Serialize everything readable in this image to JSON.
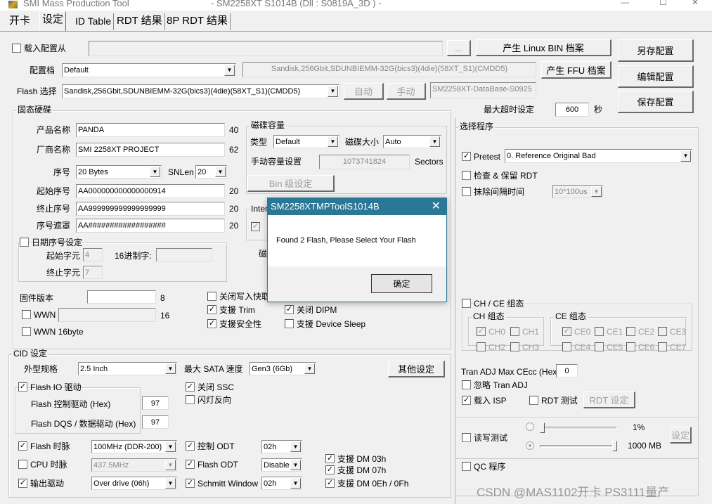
{
  "window": {
    "app_title": "SMI Mass Production Tool",
    "subtitle": "- SM2258XT    S1014B     (Dll : S0819A_3D ) -",
    "min": "—",
    "max": "☐",
    "close": "✕"
  },
  "tabs": [
    "开卡",
    "设定",
    "ID Table",
    "RDT 结果",
    "8P RDT 结果"
  ],
  "active_tab": "设定",
  "top": {
    "load_config": {
      "label": "载入配置从",
      "checked": false
    },
    "load_path": "",
    "browse": "...",
    "linux_bin": "产生 Linux BIN 档案",
    "save_as": "另存配置",
    "config_label": "配置档",
    "config_value": "Default",
    "config_info": "Sandisk,256Gbit,SDUNBIEMM-32G(bics3)(4die)(58XT_S1)(CMDD5)",
    "ffu": "产生 FFU 档案",
    "edit": "编辑配置",
    "flash_label": "Flash 选择",
    "flash_value": "Sandisk,256Gbit,SDUNBIEMM-32G(bics3)(4die)(58XT_S1)(CMDD5)",
    "auto": "自动",
    "manual": "手动",
    "database": "SM2258XT-DataBase-S0925",
    "save": "保存配置",
    "timeout_label": "最大超时设定",
    "timeout": "600",
    "timeout_unit": "秒"
  },
  "ssd": {
    "title": "固态硬碟",
    "product_label": "产品名称",
    "product": "PANDA",
    "product_len": "40",
    "vendor_label": "厂商名称",
    "vendor": "SMI 2258XT PROJECT",
    "vendor_len": "62",
    "sn_label": "序号",
    "sn_type": "20 Bytes",
    "snlen_label": "SNLen",
    "snlen": "20",
    "start_sn_label": "起始序号",
    "start_sn": "AA000000000000000914",
    "start_sn_len": "20",
    "end_sn_label": "终止序号",
    "end_sn": "AA999999999999999999",
    "end_sn_len": "20",
    "mask_label": "序号遮罩",
    "mask": "AA##################",
    "mask_len": "20",
    "date_sn": {
      "label": "日期序号设定",
      "checked": false
    },
    "start_char_label": "起始字元",
    "start_char": "4",
    "hex_label": "16进制字:",
    "hex": "",
    "end_char_label": "终止字元",
    "end_char": "7",
    "fw_label": "固件版本",
    "fw": "",
    "fw_len": "8",
    "wwn": {
      "label": "WWN",
      "checked": false
    },
    "wwn_value": "",
    "wwn_len": "16",
    "wwn16": {
      "label": "WWN 16byte",
      "checked": false
    },
    "disable_write_cache": {
      "label": "关闭写入快取",
      "checked": false
    },
    "trim": {
      "label": "支援 Trim",
      "checked": true
    },
    "security": {
      "label": "支援安全性",
      "checked": true
    },
    "dipm": {
      "label": "关闭 DIPM",
      "checked": true
    },
    "devsleep": {
      "label": "支援 Device Sleep",
      "checked": false
    }
  },
  "capacity": {
    "title": "磁碟容量",
    "type_label": "类型",
    "type": "Default",
    "size_label": "磁碟大小",
    "size": "Auto",
    "manual_label": "手动容量设置",
    "manual": "1073741824",
    "unit": "Sectors",
    "bin": "Bin 级设定"
  },
  "interface": {
    "title": "Inter",
    "opt": {
      "label": "",
      "checked": true
    },
    "partial": "磁"
  },
  "cid": {
    "title": "CID 设定",
    "form_label": "外型规格",
    "form": "2.5 Inch",
    "sata_label": "最大 SATA 速度",
    "sata": "Gen3 (6Gb)",
    "other": "其他设定",
    "flash_io": {
      "label": "Flash IO 驱动",
      "checked": true
    },
    "ctrl_drive_label": "Flash 控制驱动 (Hex)",
    "ctrl_drive": "97",
    "dqs_label": "Flash DQS / 数据驱动 (Hex)",
    "dqs": "97",
    "ssc": {
      "label": "关闭 SSC",
      "checked": true
    },
    "led": {
      "label": "闪灯反向",
      "checked": false
    },
    "flash_clock": {
      "label": "Flash 时脉",
      "checked": true
    },
    "flash_clock_value": "100MHz (DDR-200)",
    "cpu_clock": {
      "label": "CPU 时脉",
      "checked": false
    },
    "cpu_clock_value": "437.5MHz",
    "output_drive": {
      "label": "输出驱动",
      "checked": true
    },
    "output_drive_value": "Over drive (06h)",
    "ctrl_odt": {
      "label": "控制 ODT",
      "checked": true
    },
    "ctrl_odt_value": "02h",
    "flash_odt": {
      "label": "Flash ODT",
      "checked": true
    },
    "flash_odt_value": "Disable",
    "schmitt": {
      "label": "Schmitt Window",
      "checked": true
    },
    "schmitt_value": "02h",
    "dm03": {
      "label": "支援 DM 03h",
      "checked": true
    },
    "dm07": {
      "label": "支援 DM 07h",
      "checked": true
    },
    "dm0e": {
      "label": "支援 DM 0Eh / 0Fh",
      "checked": true
    }
  },
  "program": {
    "title": "选择程序",
    "pretest": {
      "label": "Pretest",
      "checked": true
    },
    "pretest_value": "0. Reference Original Bad",
    "check_rdt": {
      "label": "检查 & 保留 RDT",
      "checked": false
    },
    "erase_interval": {
      "label": "抹除间隔时间",
      "checked": false
    },
    "erase_value": "10*100us",
    "chce": {
      "label": "CH / CE 组态",
      "checked": false
    },
    "ch_title": "CH 组态",
    "ce_title": "CE 组态",
    "ch": [
      {
        "label": "CH0",
        "checked": true
      },
      {
        "label": "CH1",
        "checked": false
      },
      {
        "label": "CH2",
        "checked": false
      },
      {
        "label": "CH3",
        "checked": false
      }
    ],
    "ce": [
      {
        "label": "CE0",
        "checked": true
      },
      {
        "label": "CE1",
        "checked": false
      },
      {
        "label": "CE2",
        "checked": false
      },
      {
        "label": "CE3",
        "checked": false
      },
      {
        "label": "CE4",
        "checked": false
      },
      {
        "label": "CE5",
        "checked": false
      },
      {
        "label": "CE6",
        "checked": false
      },
      {
        "label": "CE7",
        "checked": false
      }
    ],
    "tran_label": "Tran ADJ Max CEcc (Hex)",
    "tran": "0",
    "ignore_tran": {
      "label": "忽略 Tran ADJ",
      "checked": false
    },
    "load_isp": {
      "label": "载入 ISP",
      "checked": true
    },
    "rdt_test": {
      "label": "RDT 测试",
      "checked": false
    },
    "rdt_setting": "RDT 设定",
    "rw_test": {
      "label": "读写测试",
      "checked": false
    },
    "percent": "1%",
    "percent_value": 1,
    "size_mb": "1000 MB",
    "size_value": 1000,
    "rw_mode": "size",
    "rw_set": "设定",
    "qc": {
      "label": "QC 程序",
      "checked": false
    }
  },
  "dialog": {
    "title": "SM2258XTMPToolS1014B",
    "message": "Found 2 Flash, Please Select Your Flash",
    "ok": "确定",
    "close": "✕"
  },
  "watermark": "CSDN @MAS1102开卡 PS3111量产"
}
